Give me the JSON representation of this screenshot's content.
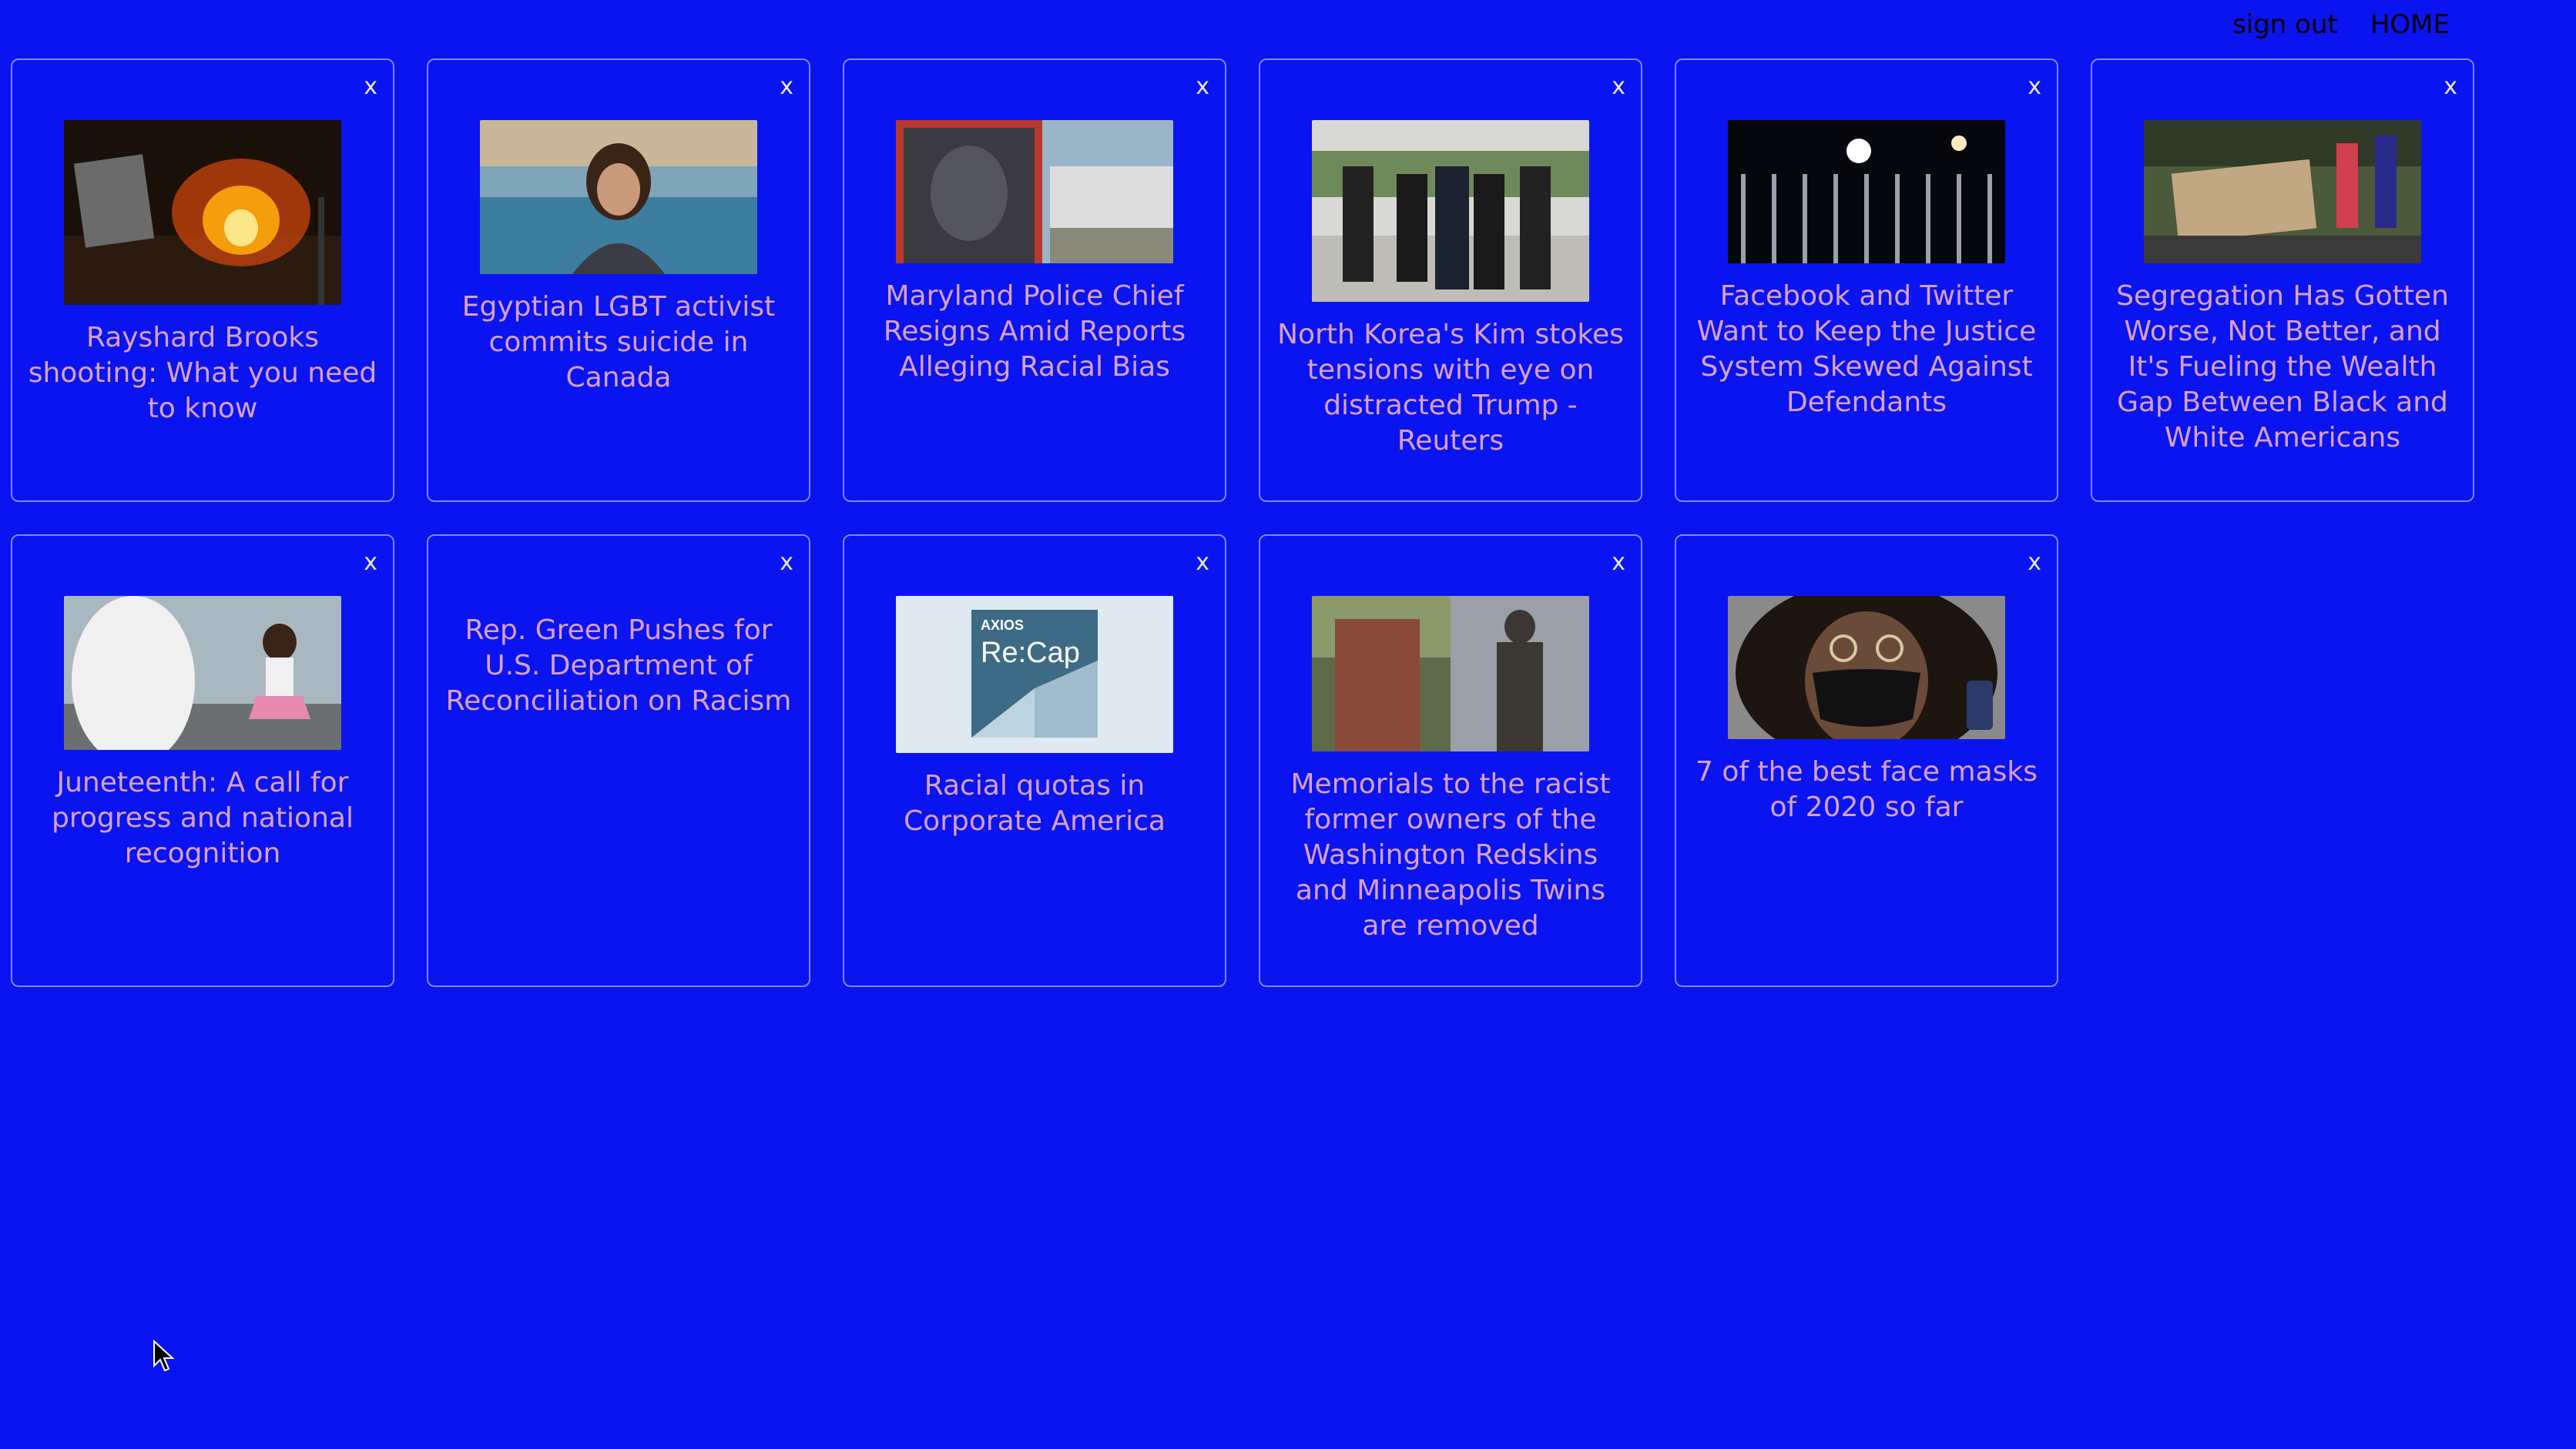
{
  "nav": {
    "sign_out": "sign out",
    "home": "HOME"
  },
  "colors": {
    "background": "#0a14f0",
    "card_border": "#7a8cff",
    "title_text": "#d9a0c6",
    "nav_text": "#000000"
  },
  "cards": [
    {
      "title": "Rayshard Brooks shooting: What you need to know",
      "close": "x",
      "image": "burning-building-night-photo"
    },
    {
      "title": "Egyptian LGBT activist commits suicide in Canada",
      "close": "x",
      "image": "woman-by-water-photo"
    },
    {
      "title": "Maryland Police Chief Resigns Amid Reports Alleging Racial Bias",
      "close": "x",
      "image": "mural-portrait-photo"
    },
    {
      "title": "North Korea's Kim stokes tensions with eye on distracted Trump - Reuters",
      "close": "x",
      "image": "press-crowd-photo"
    },
    {
      "title": "Facebook and Twitter Want to Keep the Justice System Skewed Against Defendants",
      "close": "x",
      "image": "night-fence-lights-photo"
    },
    {
      "title": "Segregation Has Gotten Worse, Not Better, and It's Fueling the Wealth Gap Between Black and White Americans",
      "close": "x",
      "image": "protest-sign-photo"
    },
    {
      "title": "Juneteenth: A call for progress and national recognition",
      "close": "x",
      "image": "child-dancing-photo"
    },
    {
      "title": "Rep. Green Pushes for U.S. Department of Reconciliation on Racism",
      "close": "x",
      "image": null
    },
    {
      "title": "Racial quotas in Corporate America",
      "close": "x",
      "image": "axios-recap-logo",
      "logo_brand": "AXIOS",
      "logo_text": "Re:Cap"
    },
    {
      "title": "Memorials to the racist former owners of the Washington Redskins and Minneapolis Twins are removed",
      "close": "x",
      "image": "statue-memorial-photo"
    },
    {
      "title": "7 of the best face masks of 2020 so far",
      "close": "x",
      "image": "face-mask-portrait-photo"
    }
  ]
}
